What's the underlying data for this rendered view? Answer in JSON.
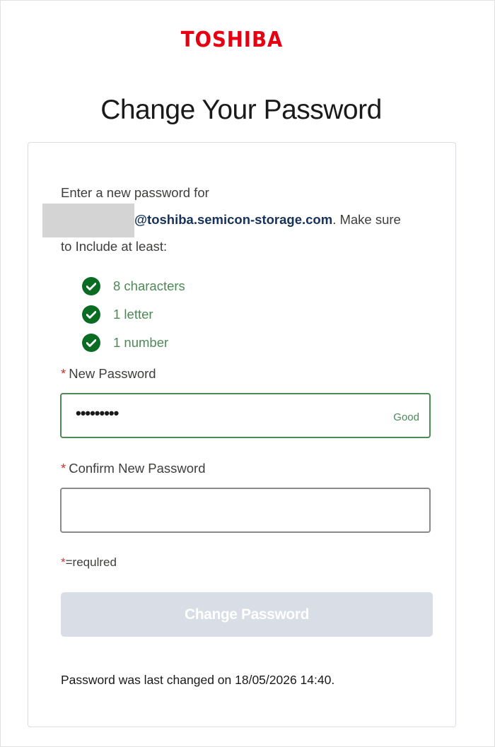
{
  "brand": {
    "logo_text": "TOSHIBA",
    "logo_color": "#e60012"
  },
  "page_title": "Change Your Password",
  "intro": {
    "line1": "Enter a new password for",
    "email_domain": "@toshiba.semicon-storage.com",
    "after_email": ". Make sure",
    "line3": "to Include at least:"
  },
  "requirements": [
    {
      "label": "8 characters",
      "met": true,
      "icon": "check-circle-icon"
    },
    {
      "label": "1 letter",
      "met": true,
      "icon": "check-circle-icon"
    },
    {
      "label": "1 number",
      "met": true,
      "icon": "check-circle-icon"
    }
  ],
  "new_password": {
    "label": "New Password",
    "required_mark": "*",
    "masked_value": "•••••••••",
    "strength": "Good"
  },
  "confirm_password": {
    "label": "Confirm New Password",
    "required_mark": "*",
    "value": ""
  },
  "required_note": {
    "mark": "*",
    "text": "=requlred"
  },
  "submit": {
    "label": "Change Password",
    "enabled": false
  },
  "last_changed": "Password was last changed on 18/05/2026 14:40.",
  "colors": {
    "valid_green": "#4b8a55",
    "check_green": "#0a6b22",
    "required_red": "#c23934",
    "disabled_button": "#d8dde6"
  }
}
